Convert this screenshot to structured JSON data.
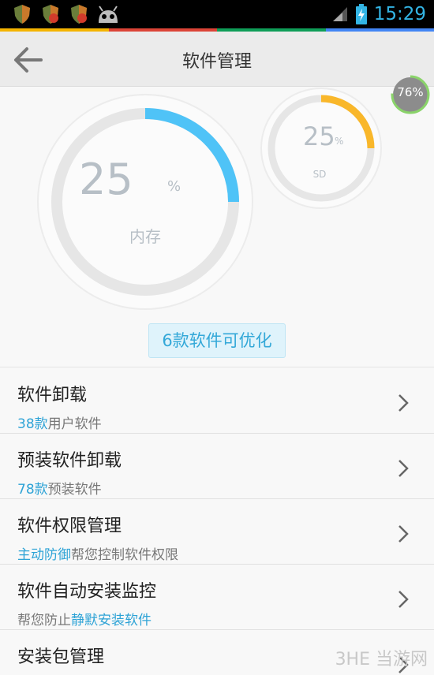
{
  "status_bar": {
    "time": "15:29",
    "icons": [
      "shield-icon",
      "shield-icon",
      "shield-icon",
      "cyanogen-android-icon",
      "signal-icon",
      "battery-charging-icon"
    ]
  },
  "header": {
    "title": "软件管理",
    "back_icon": "back-arrow-icon"
  },
  "gauges": {
    "memory": {
      "value": "25",
      "unit": "%",
      "label": "内存",
      "fraction": 0.25,
      "color": "#4fc3f7"
    },
    "sd": {
      "value": "25",
      "unit": "%",
      "label": "SD",
      "fraction": 0.25,
      "color": "#f9b72a"
    },
    "mini": {
      "value": "76%",
      "fraction": 0.76,
      "color": "#8ad36a"
    }
  },
  "optimize_button": {
    "label": "6款软件可优化"
  },
  "list": [
    {
      "title": "软件卸载",
      "sub_hl": "38款",
      "sub_text": "用户软件",
      "hl_first": true
    },
    {
      "title": "预装软件卸载",
      "sub_hl": "78款",
      "sub_text": "预装软件",
      "hl_first": true
    },
    {
      "title": "软件权限管理",
      "sub_hl": "主动防御",
      "sub_text": "帮您控制软件权限",
      "hl_first": true
    },
    {
      "title": "软件自动安装监控",
      "sub_hl": "静默安装软件",
      "sub_text": "帮您防止",
      "hl_first": false
    },
    {
      "title": "安装包管理",
      "sub_hl": "",
      "sub_text": "",
      "hl_first": true
    }
  ],
  "watermark": "3HE 当游网",
  "colors": {
    "accent": "#33b5e5",
    "highlight": "#2ea3d6"
  }
}
